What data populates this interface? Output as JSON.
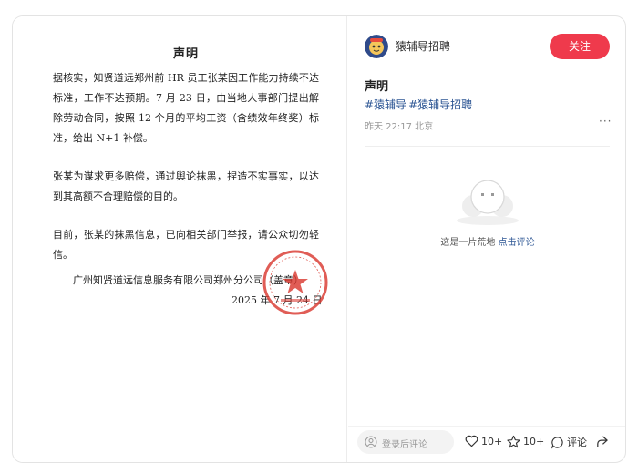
{
  "document": {
    "title": "声明",
    "paragraphs": [
      "据核实，知贤道远郑州前 HR 员工张某因工作能力持续不达标准，工作不达预期。7 月 23 日，由当地人事部门提出解除劳动合同，按照 12 个月的平均工资（含绩效年终奖）标准，给出 N+1 补偿。",
      "张某为谋求更多赔偿，通过舆论抹黑，捏造不实事实，以达到其高额不合理赔偿的目的。",
      "目前，张某的抹黑信息，已向相关部门举报，请公众切勿轻信。"
    ],
    "signature": "广州知贤道远信息服务有限公司郑州分公司（盖章）",
    "date": "2025 年 7 月 24 日"
  },
  "post": {
    "author": "猿辅导招聘",
    "follow_label": "关注",
    "title": "声明",
    "tags": [
      "#猿辅导",
      "#猿辅导招聘"
    ],
    "meta": "昨天 22:17 北京",
    "more": "···"
  },
  "comments": {
    "empty_text": "这是一片荒地",
    "empty_link": "点击评论"
  },
  "bottom_bar": {
    "comment_placeholder": "登录后评论",
    "like_count": "10+",
    "collect_count": "10+",
    "comment_label": "评论"
  },
  "colors": {
    "accent": "#ef3a4c",
    "tag": "#2d5694",
    "seal": "#d9352c"
  }
}
